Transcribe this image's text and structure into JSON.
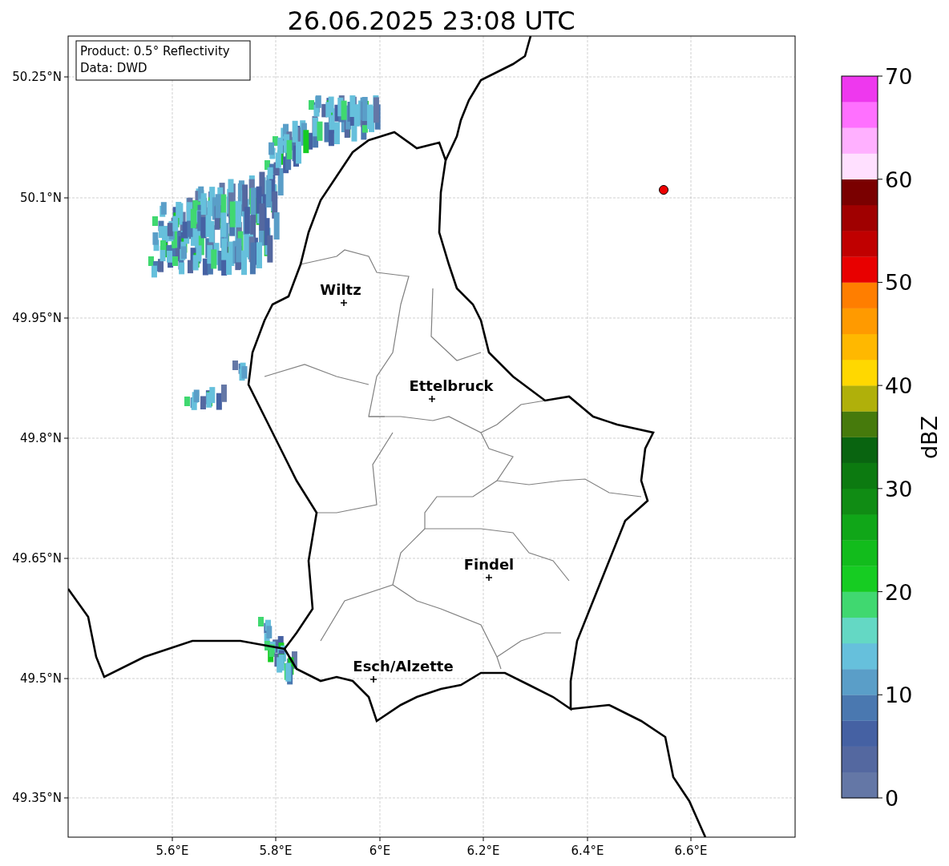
{
  "title": "26.06.2025 23:08 UTC",
  "info_box": [
    "Product: 0.5° Reflectivity",
    "Data: DWD"
  ],
  "map": {
    "lat_ticks": [
      "50.25°N",
      "50.1°N",
      "49.95°N",
      "49.8°N",
      "49.65°N",
      "49.5°N",
      "49.35°N"
    ],
    "lon_ticks": [
      "5.6°E",
      "5.8°E",
      "6°E",
      "6.2°E",
      "6.4°E",
      "6.6°E"
    ],
    "cities": [
      {
        "name": "Wiltz"
      },
      {
        "name": "Ettelbruck"
      },
      {
        "name": "Findel"
      },
      {
        "name": "Esch/Alzette"
      }
    ]
  },
  "colorbar": {
    "label": "dBZ",
    "ticks": [
      "70",
      "60",
      "50",
      "40",
      "30",
      "20",
      "10",
      "0"
    ],
    "segments": [
      {
        "color": "#6477a6"
      },
      {
        "color": "#5468a0"
      },
      {
        "color": "#4561a3"
      },
      {
        "color": "#4a78b0"
      },
      {
        "color": "#5a9ec8"
      },
      {
        "color": "#66c0dc"
      },
      {
        "color": "#64d8c4"
      },
      {
        "color": "#40d870"
      },
      {
        "color": "#16cc22"
      },
      {
        "color": "#12bc1c"
      },
      {
        "color": "#10a618"
      },
      {
        "color": "#108c14"
      },
      {
        "color": "#0c7a10"
      },
      {
        "color": "#096410"
      },
      {
        "color": "#467a0c"
      },
      {
        "color": "#b0b00a"
      },
      {
        "color": "#ffd800"
      },
      {
        "color": "#ffb800"
      },
      {
        "color": "#ff9a00"
      },
      {
        "color": "#ff7e00"
      },
      {
        "color": "#e80000"
      },
      {
        "color": "#c00000"
      },
      {
        "color": "#a00000"
      },
      {
        "color": "#7a0000"
      },
      {
        "color": "#ffe0ff"
      },
      {
        "color": "#ffb0ff"
      },
      {
        "color": "#ff70ff"
      },
      {
        "color": "#ee38ee"
      }
    ]
  }
}
